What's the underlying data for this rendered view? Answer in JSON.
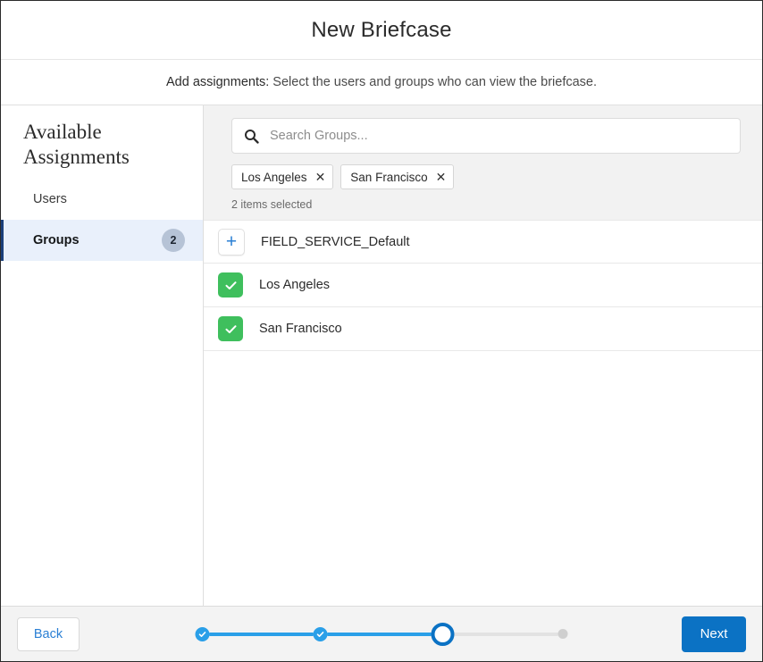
{
  "header": {
    "title": "New Briefcase"
  },
  "subheader": {
    "lead": "Add assignments:",
    "rest": " Select the users and groups who can view the briefcase."
  },
  "sidebar": {
    "heading": "Available Assignments",
    "items": [
      {
        "label": "Users",
        "badge": "",
        "selected": false
      },
      {
        "label": "Groups",
        "badge": "2",
        "selected": true
      }
    ]
  },
  "search": {
    "icon": "search-icon",
    "placeholder": "Search Groups...",
    "value": "",
    "chips": [
      {
        "label": "Los Angeles",
        "remove": "✕"
      },
      {
        "label": "San Francisco",
        "remove": "✕"
      }
    ],
    "selected_count": "2 items selected"
  },
  "list": {
    "rows": [
      {
        "label": "FIELD_SERVICE_Default",
        "state": "add",
        "icon": "plus-icon"
      },
      {
        "label": "Los Angeles",
        "state": "checked",
        "icon": "check-icon"
      },
      {
        "label": "San Francisco",
        "state": "checked",
        "icon": "check-icon"
      }
    ]
  },
  "footer": {
    "back_label": "Back",
    "next_label": "Next",
    "progress": {
      "steps": [
        "done",
        "done",
        "active",
        "todo"
      ],
      "current_step": 3,
      "total_steps": 4
    }
  },
  "colors": {
    "accent_blue": "#0b72c4",
    "step_blue": "#2a9fe8",
    "check_green": "#3fbf5d",
    "selected_bg": "#e9f0fb",
    "selected_bar": "#1b3f7a",
    "badge_bg": "#b6c3d6",
    "panel_gray": "#f2f2f2",
    "footer_gray": "#f3f3f3"
  }
}
